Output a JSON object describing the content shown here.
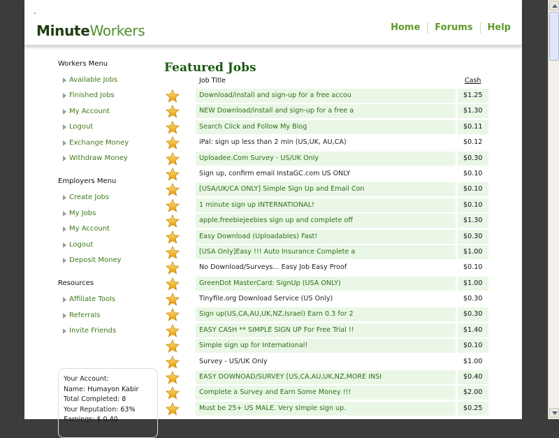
{
  "header": {
    "logo_part1": "Minute",
    "logo_part2": "Workers",
    "nav": [
      "Home",
      "Forums",
      "Help"
    ]
  },
  "sidebar": {
    "workers_menu": {
      "title": "Workers Menu",
      "items": [
        "Available Jobs",
        "Finished Jobs",
        "My Account",
        "Logout",
        "Exchange Money",
        "Withdraw Money"
      ]
    },
    "employers_menu": {
      "title": "Employers Menu",
      "items": [
        "Create Jobs",
        "My Jobs",
        "My Account",
        "Logout",
        "Deposit Money"
      ]
    },
    "resources": {
      "title": "Resources",
      "items": [
        "Affiliate Tools",
        "Referrals",
        "Invite Friends"
      ]
    },
    "account": {
      "title": "Your Account:",
      "name_label": "Name:",
      "name": "Humayon Kabir",
      "completed_label": "Total Completed:",
      "completed": "8",
      "reputation_label": "Your Reputation:",
      "reputation": "63%",
      "earnings_label": "Earnings:",
      "earnings": "$ 0.40"
    }
  },
  "main": {
    "title": "Featured Jobs",
    "col_title": "Job Title",
    "col_cash": "Cash",
    "rows": [
      {
        "title": "Download/install and sign-up for a free accou",
        "cash": "$1.25"
      },
      {
        "title": "NEW Download/install and sign-up for a free a",
        "cash": "$1.30"
      },
      {
        "title": "Search Click and Follow My Blog",
        "cash": "$0.11"
      },
      {
        "title": "iPal: sign up less than 2 min (US,UK, AU,CA)",
        "cash": "$0.12"
      },
      {
        "title": "Uploadee.Com Survey - US/UK Only",
        "cash": "$0.30"
      },
      {
        "title": "Sign up, confirm email InstaGC.com US ONLY",
        "cash": "$0.10"
      },
      {
        "title": "[USA/UK/CA ONLY] Simple Sign Up and Email Con",
        "cash": "$0.10"
      },
      {
        "title": "1 minute sign up INTERNATIONAL!",
        "cash": "$0.10"
      },
      {
        "title": "apple.freebiejeebies sign up and complete off",
        "cash": "$1.30"
      },
      {
        "title": "Easy Download (Uploadables) Fast!",
        "cash": "$0.30"
      },
      {
        "title": "[USA Only]Easy !!! Auto Insurance Complete a",
        "cash": "$1.00"
      },
      {
        "title": "No Download/Surveys... Easy Job Easy Proof",
        "cash": "$0.10"
      },
      {
        "title": "GreenDot MasterCard: SignUp (USA ONLY)",
        "cash": "$1.00"
      },
      {
        "title": "Tinyfile.org Download Service (US Only)",
        "cash": "$0.30"
      },
      {
        "title": "Sign up(US,CA,AU,UK,NZ,Israel) Earn 0.3 for 2",
        "cash": "$0.30"
      },
      {
        "title": "EASY CASH ** SIMPLE SIGN UP For Free Trial !!",
        "cash": "$1.40"
      },
      {
        "title": "Simple sign up for International!",
        "cash": "$0.10"
      },
      {
        "title": "Survey - US/UK Only",
        "cash": "$1.00"
      },
      {
        "title": "EASY DOWNOAD/SURVEY [US,CA,AU,UK,NZ,MORE INSI",
        "cash": "$0.40"
      },
      {
        "title": "Complete a Survey and Earn Some Money !!!",
        "cash": "$2.00"
      },
      {
        "title": "Must be 25+ US MALE. Very simple sign up.",
        "cash": "$0.25"
      }
    ]
  },
  "colors": {
    "brand_green": "#4f8f2c",
    "nav_green": "#5e9a2a",
    "row_highlight": "#eaf7e6",
    "star_gold": "#f2b51c"
  },
  "icons": {
    "row_icon": "star-icon",
    "menu_icon": "arrow-right-icon"
  }
}
